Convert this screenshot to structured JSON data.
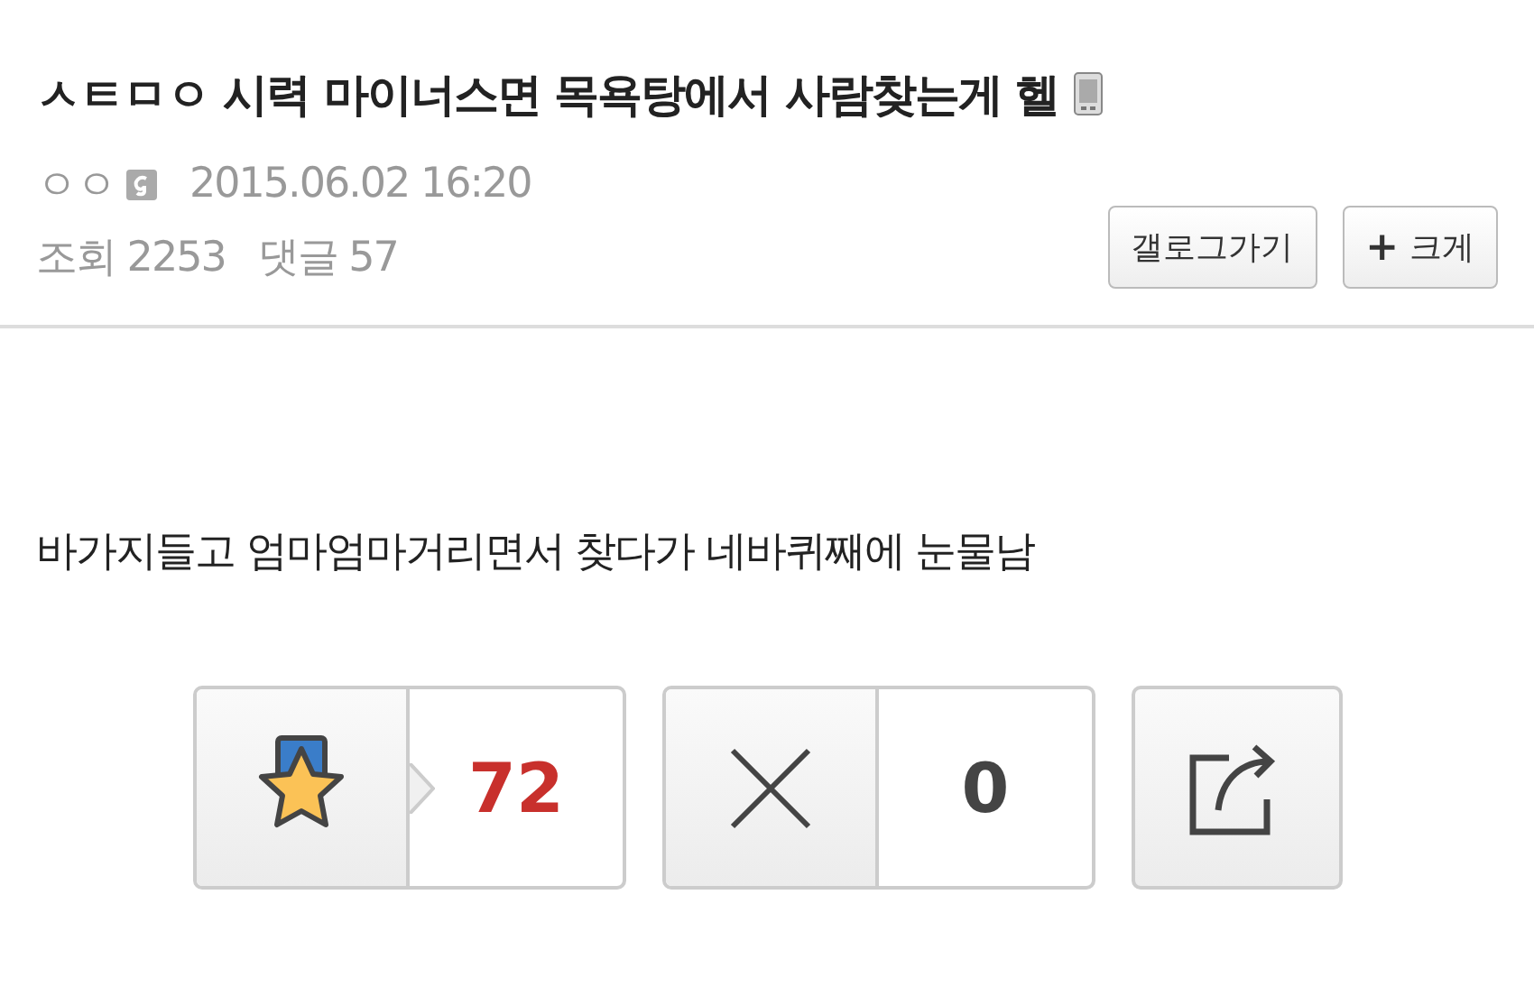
{
  "post": {
    "title": "ㅅㅌㅁㅇ 시력 마이너스면 목욕탕에서 사람찾는게 헬",
    "author": "ㅇㅇ",
    "date": "2015.06.02 16:20",
    "views_label": "조회",
    "views": "2253",
    "comments_label": "댓글",
    "comments": "57"
  },
  "buttons": [
    {
      "label": "갤로그가기"
    },
    {
      "icon": "+",
      "label": "크게"
    }
  ],
  "body": "바가지들고 엄마엄마거리면서 찾다가 네바퀴째에 눈물남",
  "votes": {
    "recommend": "72",
    "not_recommend": "0"
  }
}
